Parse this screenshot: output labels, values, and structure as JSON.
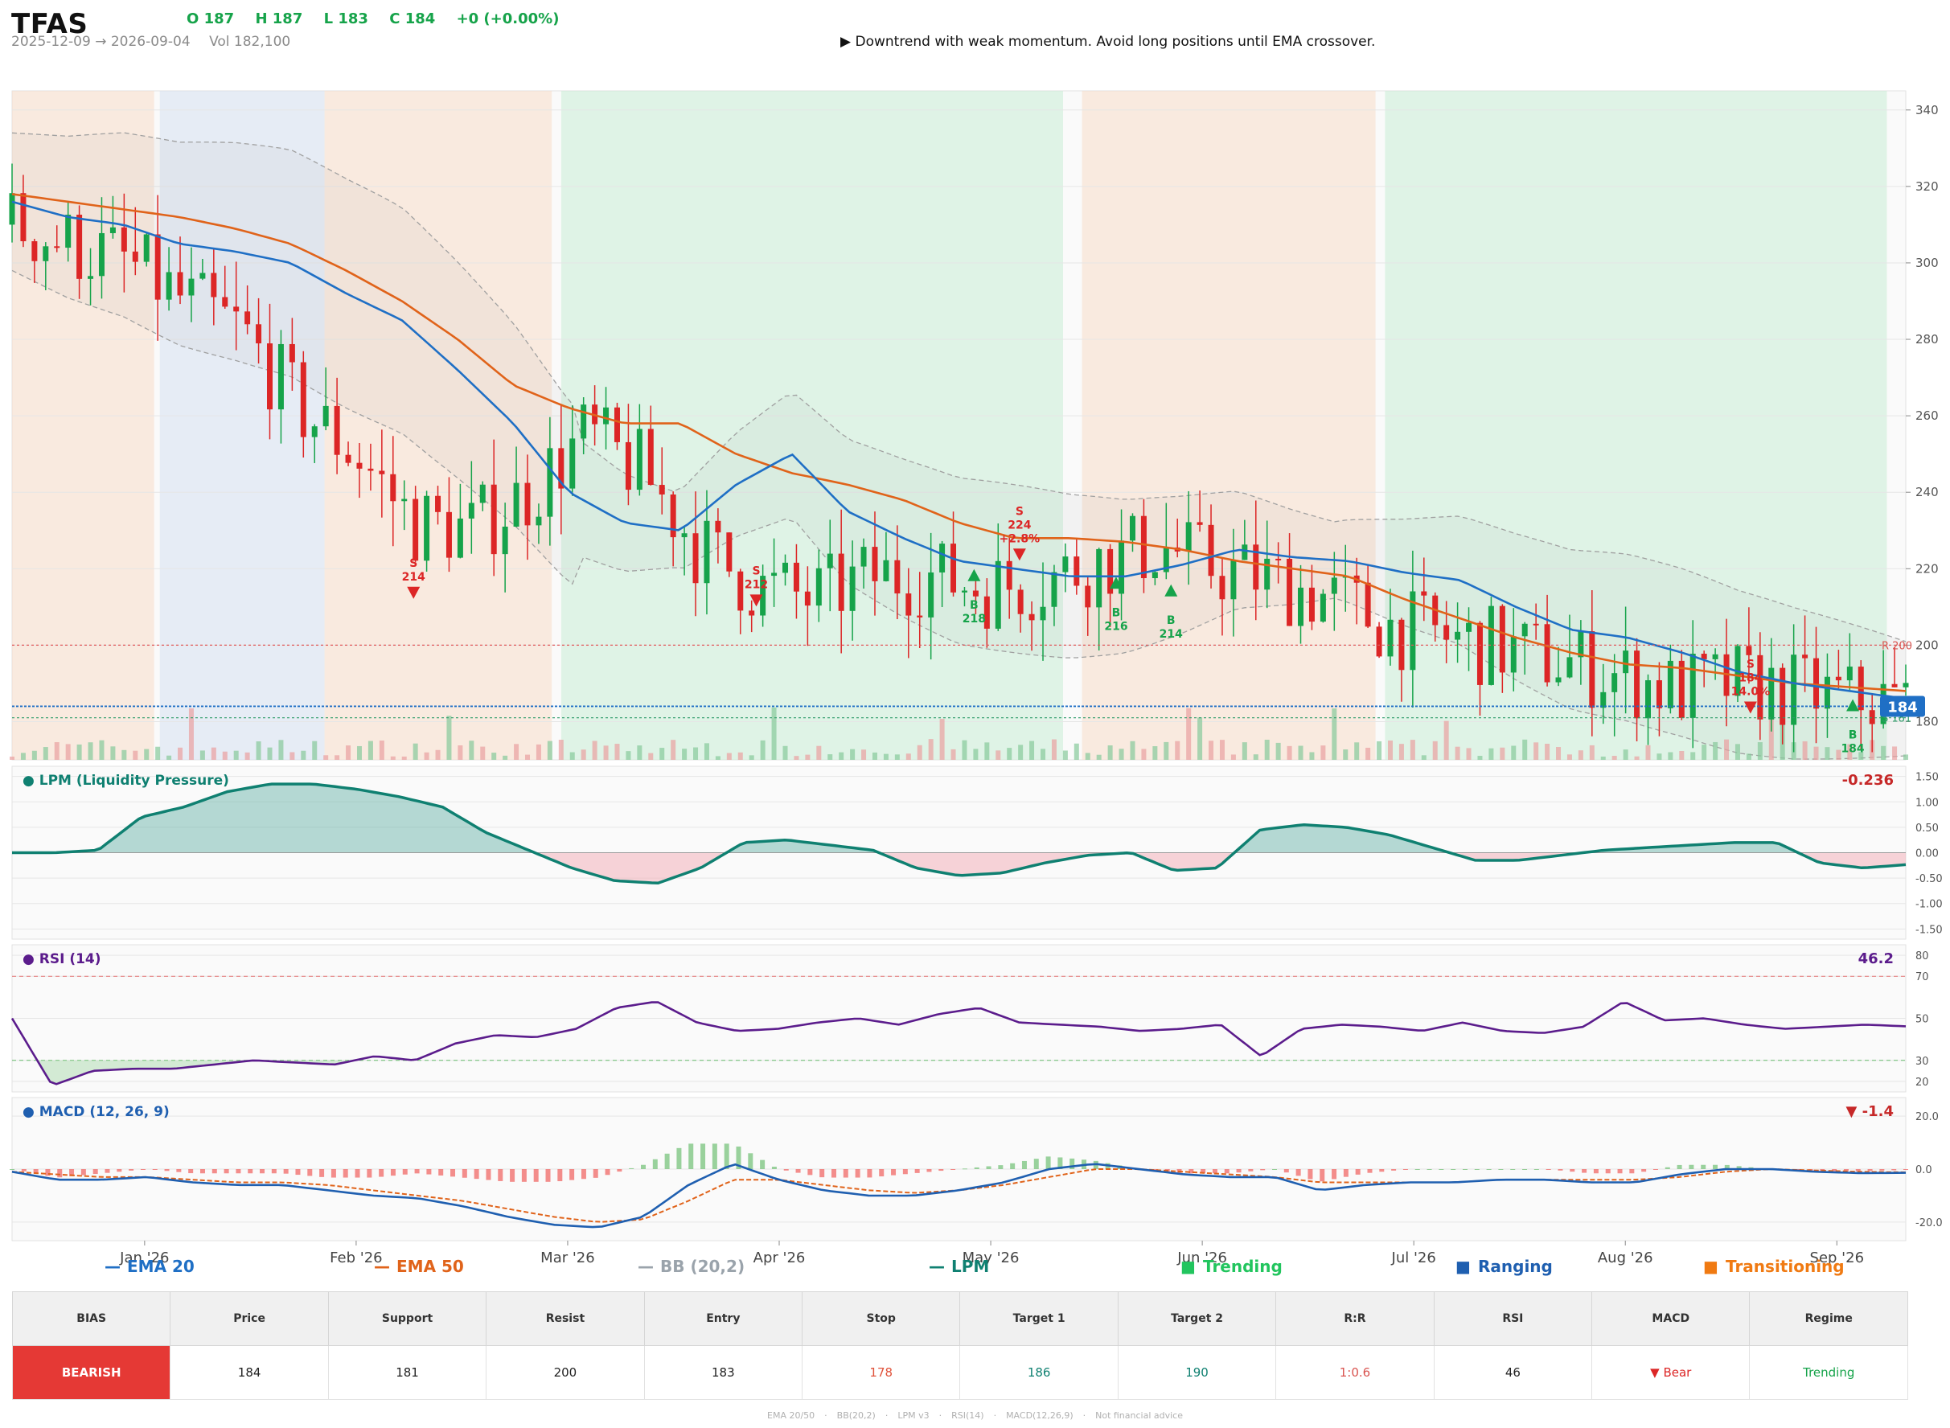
{
  "header": {
    "ticker": "TFAS",
    "ohlc": {
      "o": "O 187",
      "h": "H 187",
      "l": "L 183",
      "c": "C 184",
      "chg": "+0  (+0.00%)"
    },
    "range": "2025-12-09 → 2026-09-04",
    "volume": "Vol 182,100",
    "note": "▶  Downtrend with weak momentum. Avoid long positions until EMA crossover."
  },
  "colors": {
    "up": "#16a34a",
    "down": "#dc2626",
    "ema20": "#1f6fc5",
    "ema50": "#e0631a",
    "bb": "#a0a0a0",
    "lpm": "#0f8071",
    "rsi": "#5b1c8c",
    "trending": "#c9ecd6",
    "ranging": "#d5e0f1",
    "transitioning": "#f7dcc9",
    "price_tag": "#1f6fc5"
  },
  "chart_data": [
    {
      "type": "candlestick",
      "title": "",
      "x_dates": [
        "2025-12-09",
        "2026-09-04"
      ],
      "ylim": [
        170,
        345
      ],
      "yticks": [
        180,
        200,
        220,
        240,
        260,
        280,
        300,
        320,
        340
      ],
      "xticks": [
        "Jan '26",
        "Feb '26",
        "Mar '26",
        "Apr '26",
        "May '26",
        "Jun '26",
        "Jul '26",
        "Aug '26",
        "Sep '26"
      ],
      "last_price": 184,
      "last_price_label": "184",
      "resistance": {
        "value": 200,
        "label": "R 200"
      },
      "support": {
        "value": 181,
        "label": "S 181"
      },
      "regimes": [
        {
          "start": 0.0,
          "end": 0.075,
          "type": "transitioning"
        },
        {
          "start": 0.078,
          "end": 0.165,
          "type": "ranging"
        },
        {
          "start": 0.165,
          "end": 0.285,
          "type": "transitioning"
        },
        {
          "start": 0.29,
          "end": 0.555,
          "type": "trending"
        },
        {
          "start": 0.565,
          "end": 0.72,
          "type": "transitioning"
        },
        {
          "start": 0.725,
          "end": 0.99,
          "type": "trending"
        }
      ],
      "trend": [
        310,
        305,
        300,
        290,
        282,
        262,
        250,
        232,
        230,
        240,
        255,
        245,
        225,
        215,
        212,
        218,
        218,
        215,
        217,
        222,
        226,
        220,
        217,
        212,
        205,
        202,
        199,
        196,
        192,
        188,
        190,
        188,
        186,
        185
      ],
      "ema20": [
        316,
        312,
        310,
        305,
        303,
        300,
        292,
        285,
        272,
        258,
        240,
        232,
        230,
        242,
        250,
        235,
        228,
        222,
        220,
        218,
        218,
        221,
        225,
        223,
        222,
        219,
        217,
        210,
        204,
        202,
        198,
        193,
        190,
        188,
        186
      ],
      "ema50": [
        318,
        316,
        314,
        312,
        309,
        305,
        298,
        290,
        280,
        268,
        262,
        258,
        258,
        250,
        245,
        242,
        238,
        232,
        228,
        228,
        227,
        225,
        222,
        220,
        218,
        212,
        207,
        202,
        198,
        195,
        194,
        192,
        190,
        189,
        188
      ],
      "signals": [
        {
          "x": 0.212,
          "price": 214,
          "side": "S",
          "labels": [
            "S",
            "214"
          ]
        },
        {
          "x": 0.393,
          "price": 212,
          "side": "S",
          "labels": [
            "S",
            "212"
          ]
        },
        {
          "x": 0.508,
          "price": 218,
          "side": "B",
          "labels": [
            "B",
            "218"
          ]
        },
        {
          "x": 0.532,
          "price": 224,
          "side": "S",
          "labels": [
            "S",
            "224",
            "+2.8%"
          ]
        },
        {
          "x": 0.583,
          "price": 216,
          "side": "B",
          "labels": [
            "B",
            "216"
          ]
        },
        {
          "x": 0.612,
          "price": 214,
          "side": "B",
          "labels": [
            "B",
            "214"
          ]
        },
        {
          "x": 0.918,
          "price": 184,
          "side": "S",
          "labels": [
            "S",
            "184",
            "14.0%"
          ]
        },
        {
          "x": 0.972,
          "price": 184,
          "side": "B",
          "labels": [
            "B",
            "184"
          ]
        }
      ]
    },
    {
      "type": "area",
      "title": "LPM (Liquidity Pressure)",
      "current_label": "-0.236",
      "ylim": [
        -1.7,
        1.7
      ],
      "yticks": [
        -1.5,
        -1.0,
        -0.5,
        0.0,
        0.5,
        1.0,
        1.5
      ],
      "ytick_labels": [
        "-1.50",
        "-1.00",
        "-0.50",
        "0.00",
        "0.50",
        "1.00",
        "1.50"
      ],
      "values": [
        0.0,
        0.0,
        0.05,
        0.7,
        0.9,
        1.2,
        1.35,
        1.35,
        1.25,
        1.1,
        0.9,
        0.4,
        0.05,
        -0.3,
        -0.55,
        -0.6,
        -0.3,
        0.2,
        0.25,
        0.15,
        0.05,
        -0.3,
        -0.45,
        -0.4,
        -0.2,
        -0.05,
        0.0,
        -0.35,
        -0.3,
        0.45,
        0.55,
        0.5,
        0.35,
        0.1,
        -0.15,
        -0.15,
        -0.05,
        0.05,
        0.1,
        0.15,
        0.2,
        0.2,
        -0.2,
        -0.3,
        -0.236
      ]
    },
    {
      "type": "line",
      "title": "RSI (14)",
      "current_label": "46.2",
      "ylim": [
        15,
        85
      ],
      "yticks": [
        20,
        30,
        50,
        70,
        80
      ],
      "bands": [
        70,
        30
      ],
      "values": [
        50,
        18,
        25,
        26,
        26,
        28,
        30,
        29,
        28,
        32,
        30,
        38,
        42,
        41,
        45,
        55,
        58,
        48,
        44,
        45,
        48,
        50,
        47,
        52,
        55,
        48,
        47,
        46,
        44,
        45,
        47,
        32,
        45,
        47,
        46,
        44,
        48,
        44,
        43,
        46,
        58,
        49,
        50,
        47,
        45,
        46,
        47,
        46.2
      ]
    },
    {
      "type": "bar",
      "title": "MACD (12, 26, 9)",
      "current_label": "▼ -1.4",
      "ylim": [
        -27,
        27
      ],
      "yticks": [
        -20,
        0,
        20
      ],
      "ytick_labels": [
        "-20.0",
        "0.0",
        "20.0"
      ],
      "macd": [
        -1,
        -4,
        -4,
        -3,
        -5,
        -6,
        -6,
        -8,
        -10,
        -11,
        -14,
        -18,
        -21,
        -22,
        -18,
        -6,
        2,
        -4,
        -8,
        -10,
        -10,
        -8,
        -5,
        0,
        2,
        0,
        -2,
        -3,
        -3,
        -8,
        -6,
        -5,
        -5,
        -4,
        -4,
        -5,
        -5,
        -2,
        0,
        0,
        -1,
        -1.5,
        -1.4
      ],
      "signal": [
        -1,
        -2,
        -3,
        -3,
        -4,
        -5,
        -5,
        -6,
        -8,
        -10,
        -12,
        -15,
        -18,
        -20,
        -19,
        -12,
        -4,
        -4,
        -6,
        -8,
        -9,
        -8,
        -6,
        -3,
        0,
        0,
        -1,
        -2,
        -3,
        -5,
        -5,
        -5,
        -5,
        -4,
        -4,
        -4,
        -4,
        -3,
        -1,
        0,
        -0.5,
        -1,
        -1.2
      ]
    }
  ],
  "legend": [
    {
      "label": "EMA 20",
      "mark": "—",
      "color": "#1f6fc5"
    },
    {
      "label": "EMA 50",
      "mark": "—",
      "color": "#e0631a"
    },
    {
      "label": "BB (20,2)",
      "mark": "—",
      "color": "#9aa3ab"
    },
    {
      "label": "LPM",
      "mark": "—",
      "color": "#0f8071"
    },
    {
      "label": "Trending",
      "mark": "■",
      "color": "#22c55e"
    },
    {
      "label": "Ranging",
      "mark": "■",
      "color": "#1f5fb0"
    },
    {
      "label": "Transitioning",
      "mark": "■",
      "color": "#f07a12"
    }
  ],
  "table": {
    "headers": [
      "BIAS",
      "Price",
      "Support",
      "Resist",
      "Entry",
      "Stop",
      "Target 1",
      "Target 2",
      "R:R",
      "RSI",
      "MACD",
      "Regime"
    ],
    "values": [
      "BEARISH",
      "184",
      "181",
      "200",
      "183",
      "178",
      "186",
      "190",
      "1:0.6",
      "46",
      "▼ Bear",
      "Trending"
    ],
    "value_colors": [
      "#ffffff",
      "#222222",
      "#222222",
      "#222222",
      "#222222",
      "#e0523a",
      "#0f8071",
      "#0f8071",
      "#d9534f",
      "#222222",
      "#dc2626",
      "#16a34a"
    ]
  },
  "footer": [
    "EMA 20/50",
    "BB(20,2)",
    "LPM v3",
    "RSI(14)",
    "MACD(12,26,9)",
    "Not financial advice"
  ]
}
